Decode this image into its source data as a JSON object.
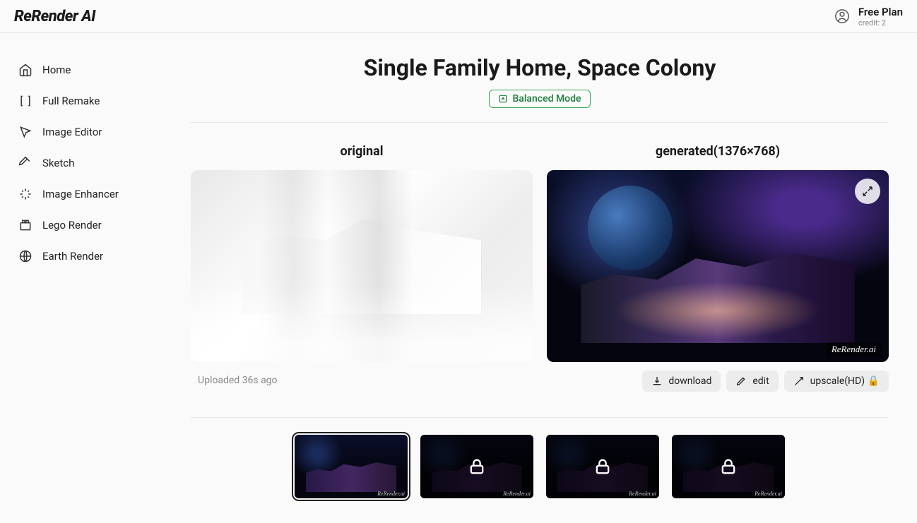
{
  "header": {
    "brand": "ReRender AI",
    "plan": "Free Plan",
    "credit": "credit: 2"
  },
  "sidebar": {
    "items": [
      {
        "label": "Home"
      },
      {
        "label": "Full Remake"
      },
      {
        "label": "Image Editor"
      },
      {
        "label": "Sketch"
      },
      {
        "label": "Image Enhancer"
      },
      {
        "label": "Lego Render"
      },
      {
        "label": "Earth Render"
      }
    ]
  },
  "page": {
    "title": "Single Family Home, Space Colony",
    "mode_label": "Balanced Mode",
    "original_label": "original",
    "generated_label": "generated(1376×768)",
    "uploaded": "Uploaded 36s ago",
    "watermark": "ReRender.ai"
  },
  "actions": {
    "download": "download",
    "edit": "edit",
    "upscale": "upscale(HD) 🔒"
  },
  "thumbs": [
    {
      "locked": false,
      "selected": true
    },
    {
      "locked": true,
      "selected": false
    },
    {
      "locked": true,
      "selected": false
    },
    {
      "locked": true,
      "selected": false
    }
  ]
}
